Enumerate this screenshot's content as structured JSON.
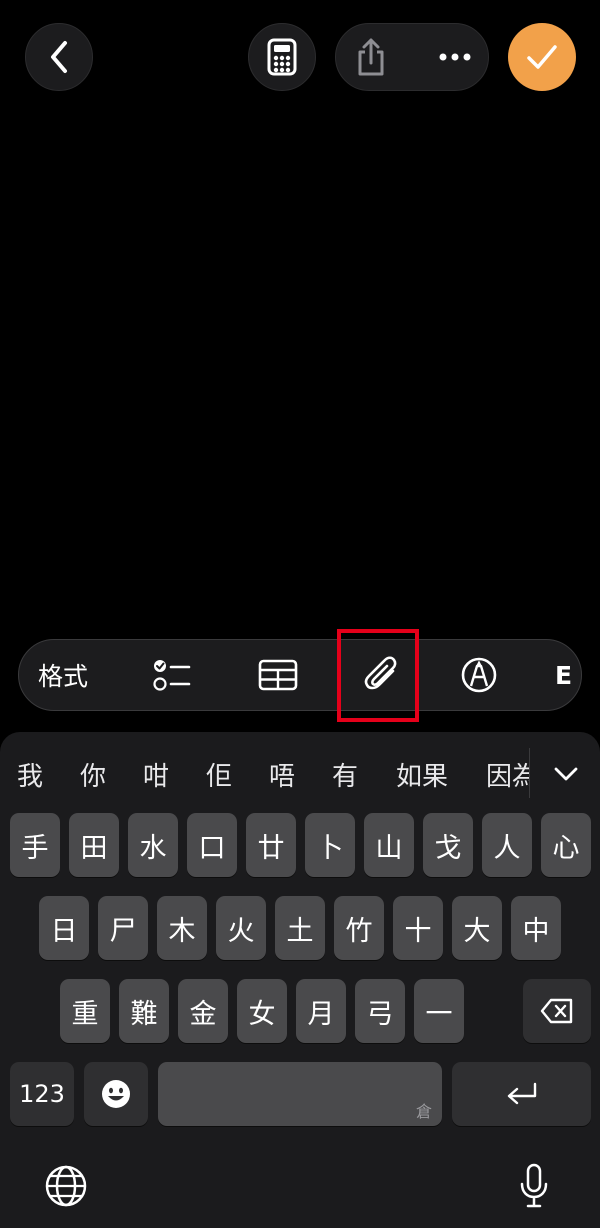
{
  "app": {
    "accent_color": "#f2a14a",
    "header": {
      "back_icon": "chevron-left-icon",
      "calculator_icon": "calculator-icon",
      "share_icon": "share-icon",
      "more_icon": "ellipsis-icon",
      "done_icon": "checkmark-icon"
    }
  },
  "format_bar": {
    "format_label": "格式",
    "tools": [
      "checklist-icon",
      "table-icon",
      "paperclip-icon",
      "markup-pen-icon"
    ],
    "partial_last_label": "E"
  },
  "keyboard": {
    "candidates": [
      "我",
      "你",
      "咁",
      "佢",
      "唔",
      "有",
      "如果",
      "因為"
    ],
    "row1": [
      "手",
      "田",
      "水",
      "口",
      "廿",
      "卜",
      "山",
      "戈",
      "人",
      "心"
    ],
    "row2": [
      "日",
      "尸",
      "木",
      "火",
      "土",
      "竹",
      "十",
      "大",
      "中"
    ],
    "row3": [
      "重",
      "難",
      "金",
      "女",
      "月",
      "弓",
      "一"
    ],
    "numbers_label": "123",
    "space_hint": "倉",
    "emoji_icon": "emoji-icon",
    "delete_icon": "backspace-icon",
    "return_icon": "return-icon",
    "globe_icon": "globe-icon",
    "mic_icon": "microphone-icon"
  }
}
